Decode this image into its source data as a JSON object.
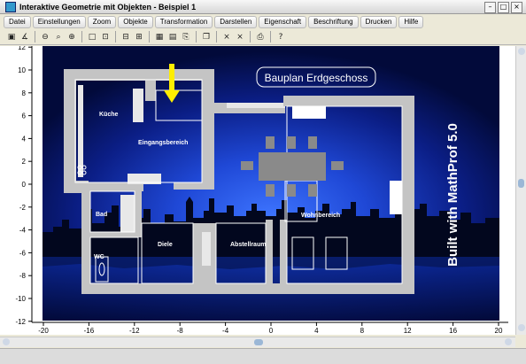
{
  "window": {
    "title": "Interaktive Geometrie mit Objekten - Beispiel 1"
  },
  "menu": [
    "Datei",
    "Einstellungen",
    "Zoom",
    "Objekte",
    "Transformation",
    "Darstellen",
    "Eigenschaft",
    "Beschriftung",
    "Drucken",
    "Hilfe"
  ],
  "toolbar": [
    {
      "name": "print-icon",
      "glyph": "▣"
    },
    {
      "name": "angle-icon",
      "glyph": "∡"
    },
    {
      "name": "zoom-out-icon",
      "glyph": "⊖"
    },
    {
      "name": "zoom-icon",
      "glyph": "⌕"
    },
    {
      "name": "zoom-in-icon",
      "glyph": "⊕"
    },
    {
      "name": "frame-icon",
      "glyph": "□"
    },
    {
      "name": "fit-icon",
      "glyph": "⊡"
    },
    {
      "name": "shrink-icon",
      "glyph": "⊟"
    },
    {
      "name": "expand-icon",
      "glyph": "⊞"
    },
    {
      "name": "table-icon",
      "glyph": "▦"
    },
    {
      "name": "calculator-icon",
      "glyph": "▤"
    },
    {
      "name": "export-icon",
      "glyph": "⎘"
    },
    {
      "name": "copy-icon",
      "glyph": "❐"
    },
    {
      "name": "cross-icon",
      "glyph": "⨯"
    },
    {
      "name": "cross-alt-icon",
      "glyph": "⨯"
    },
    {
      "name": "printer-icon",
      "glyph": "⎙"
    },
    {
      "name": "help-icon",
      "glyph": "?"
    }
  ],
  "axes": {
    "x_ticks": [
      -20,
      -16,
      -12,
      -8,
      -4,
      0,
      4,
      8,
      12,
      16,
      20
    ],
    "y_ticks": [
      12,
      10,
      8,
      6,
      4,
      2,
      0,
      -2,
      -4,
      -6,
      -8,
      -10,
      -12
    ]
  },
  "plan": {
    "title": "Bauplan Erdgeschoss",
    "watermark": "Built with MathProf 5.0",
    "rooms": {
      "kueche": "Küche",
      "eingang": "Eingangsbereich",
      "bad": "Bad",
      "wc": "WC",
      "diele": "Diele",
      "abstell": "Abstellraum",
      "wohn": "Wohnbereich"
    }
  },
  "colors": {
    "wall": "#c4c4c4",
    "background_dark": "#000a2a",
    "background_glow": "#1a4fe0",
    "arrow": "#ffee00"
  }
}
